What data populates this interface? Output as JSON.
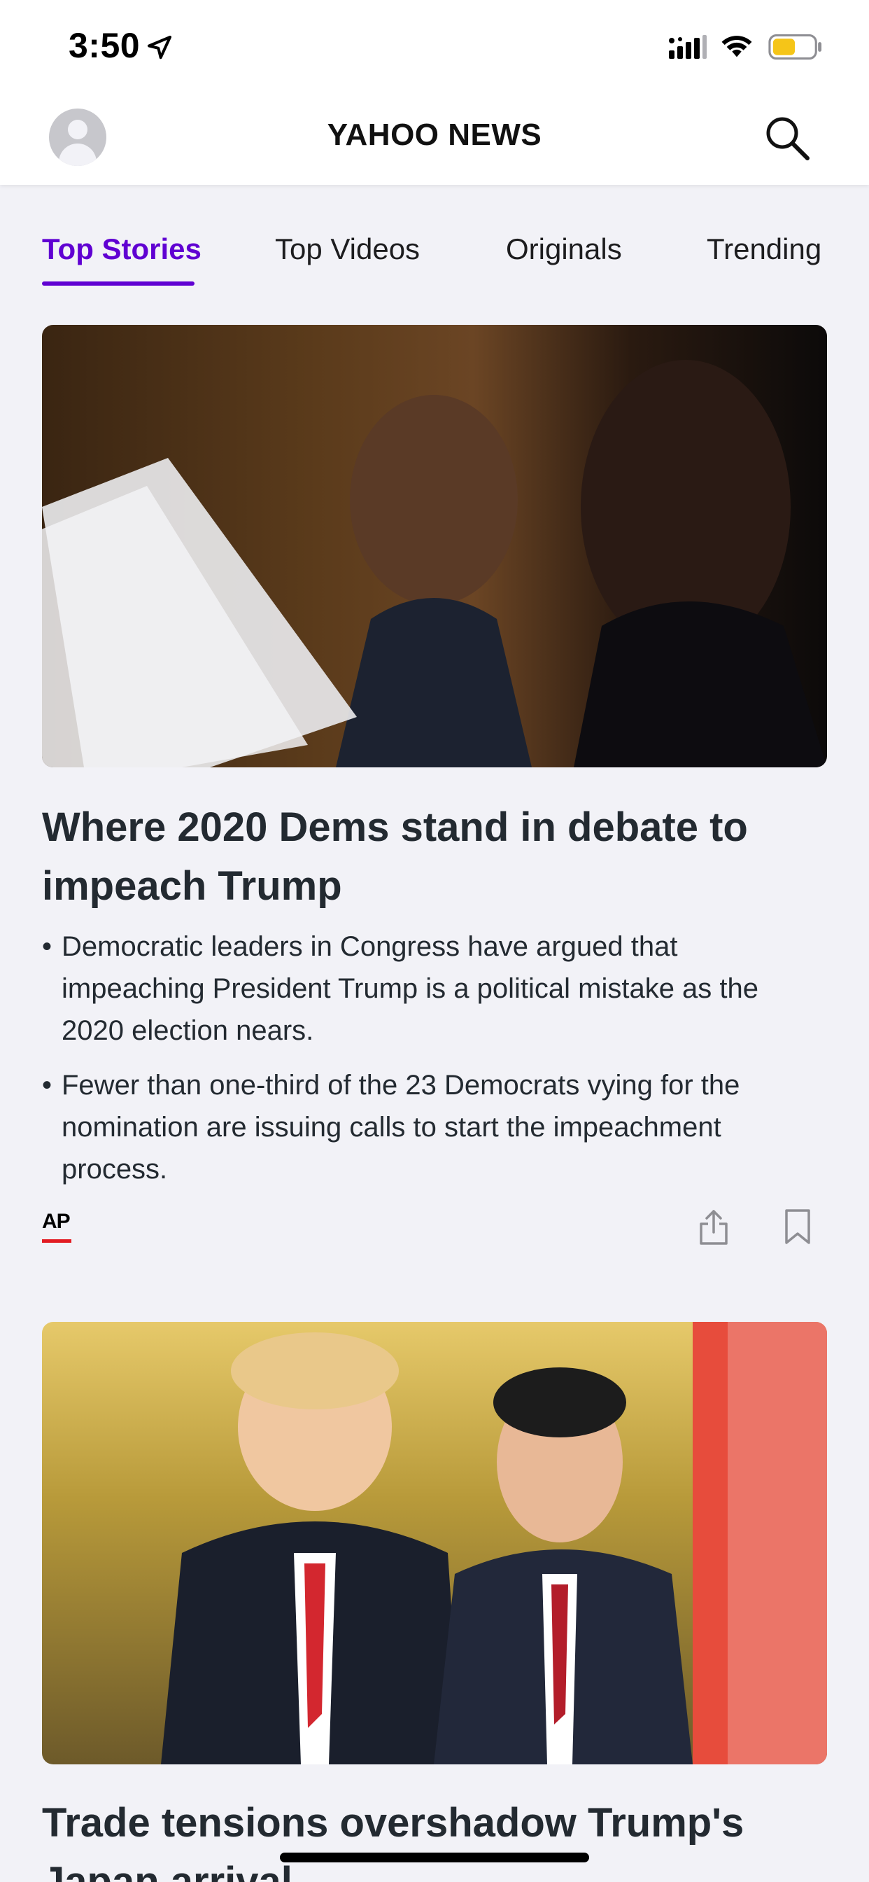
{
  "status_bar": {
    "time": "3:50"
  },
  "header": {
    "brand": "YAHOO NEWS"
  },
  "tabs": [
    {
      "label": "Top Stories",
      "active": true
    },
    {
      "label": "Top Videos",
      "active": false
    },
    {
      "label": "Originals",
      "active": false
    },
    {
      "label": "Trending",
      "active": false
    }
  ],
  "stories": [
    {
      "headline": "Where 2020 Dems stand in debate to impeach Trump",
      "bullets": [
        "Democratic leaders in Congress have argued that impeaching President Trump is a political mistake as the 2020 election nears.",
        "Fewer than one-third of the 23 Democrats vying for the nomination are issuing calls to start the impeachment process."
      ],
      "source": "AP"
    },
    {
      "headline": "Trade tensions overshadow Trump's Japan arrival"
    }
  ],
  "colors": {
    "accent": "#6001d2",
    "ap_red": "#e21b22",
    "battery": "#f5c518"
  }
}
